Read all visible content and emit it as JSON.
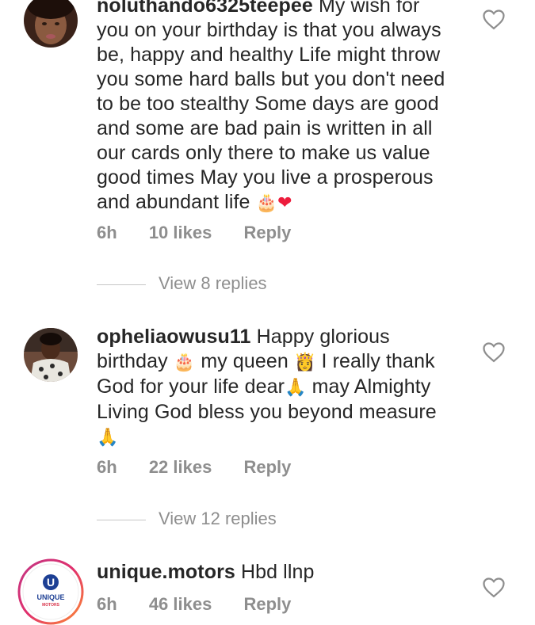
{
  "comments": [
    {
      "username": "noluthando6325teepee",
      "text_lines": [
        "My wish for",
        "you on your birthday is that you always",
        "be, happy and healthy Life might throw",
        "you some hard balls but you don't need",
        "to be too stealthy Some days are good",
        "and some are bad pain is written in all",
        "our cards only there to make us value",
        "good times May you live a prosperous",
        "and abundant life"
      ],
      "emojis_end": "🎂",
      "heart": "❤",
      "time": "6h",
      "likes": "10 likes",
      "reply": "Reply",
      "view_replies": "View 8 replies"
    },
    {
      "username": "opheliaowusu11",
      "text_lines": [
        "Happy glorious",
        "birthday",
        "my queen",
        "I really thank",
        "God for your life dear",
        "may Almighty",
        "Living God bless you beyond measure"
      ],
      "emoji_cake": "🎂",
      "emoji_queen": "👸",
      "emoji_pray": "🙏",
      "time": "6h",
      "likes": "22 likes",
      "reply": "Reply",
      "view_replies": "View 12 replies"
    },
    {
      "username": "unique.motors",
      "text": "Hbd llnp",
      "logo_letter": "U",
      "logo_line1": "UNIQUE",
      "logo_line2": "MOTORS",
      "time": "6h",
      "likes": "46 likes",
      "reply": "Reply"
    }
  ],
  "icons": {
    "like": "heart-outline-icon"
  },
  "colors": {
    "text": "#262626",
    "meta": "#8e8e8e",
    "heart": "#ed1c3c",
    "brand_ring": "#d8334a",
    "brand_blue": "#1d3f94"
  }
}
